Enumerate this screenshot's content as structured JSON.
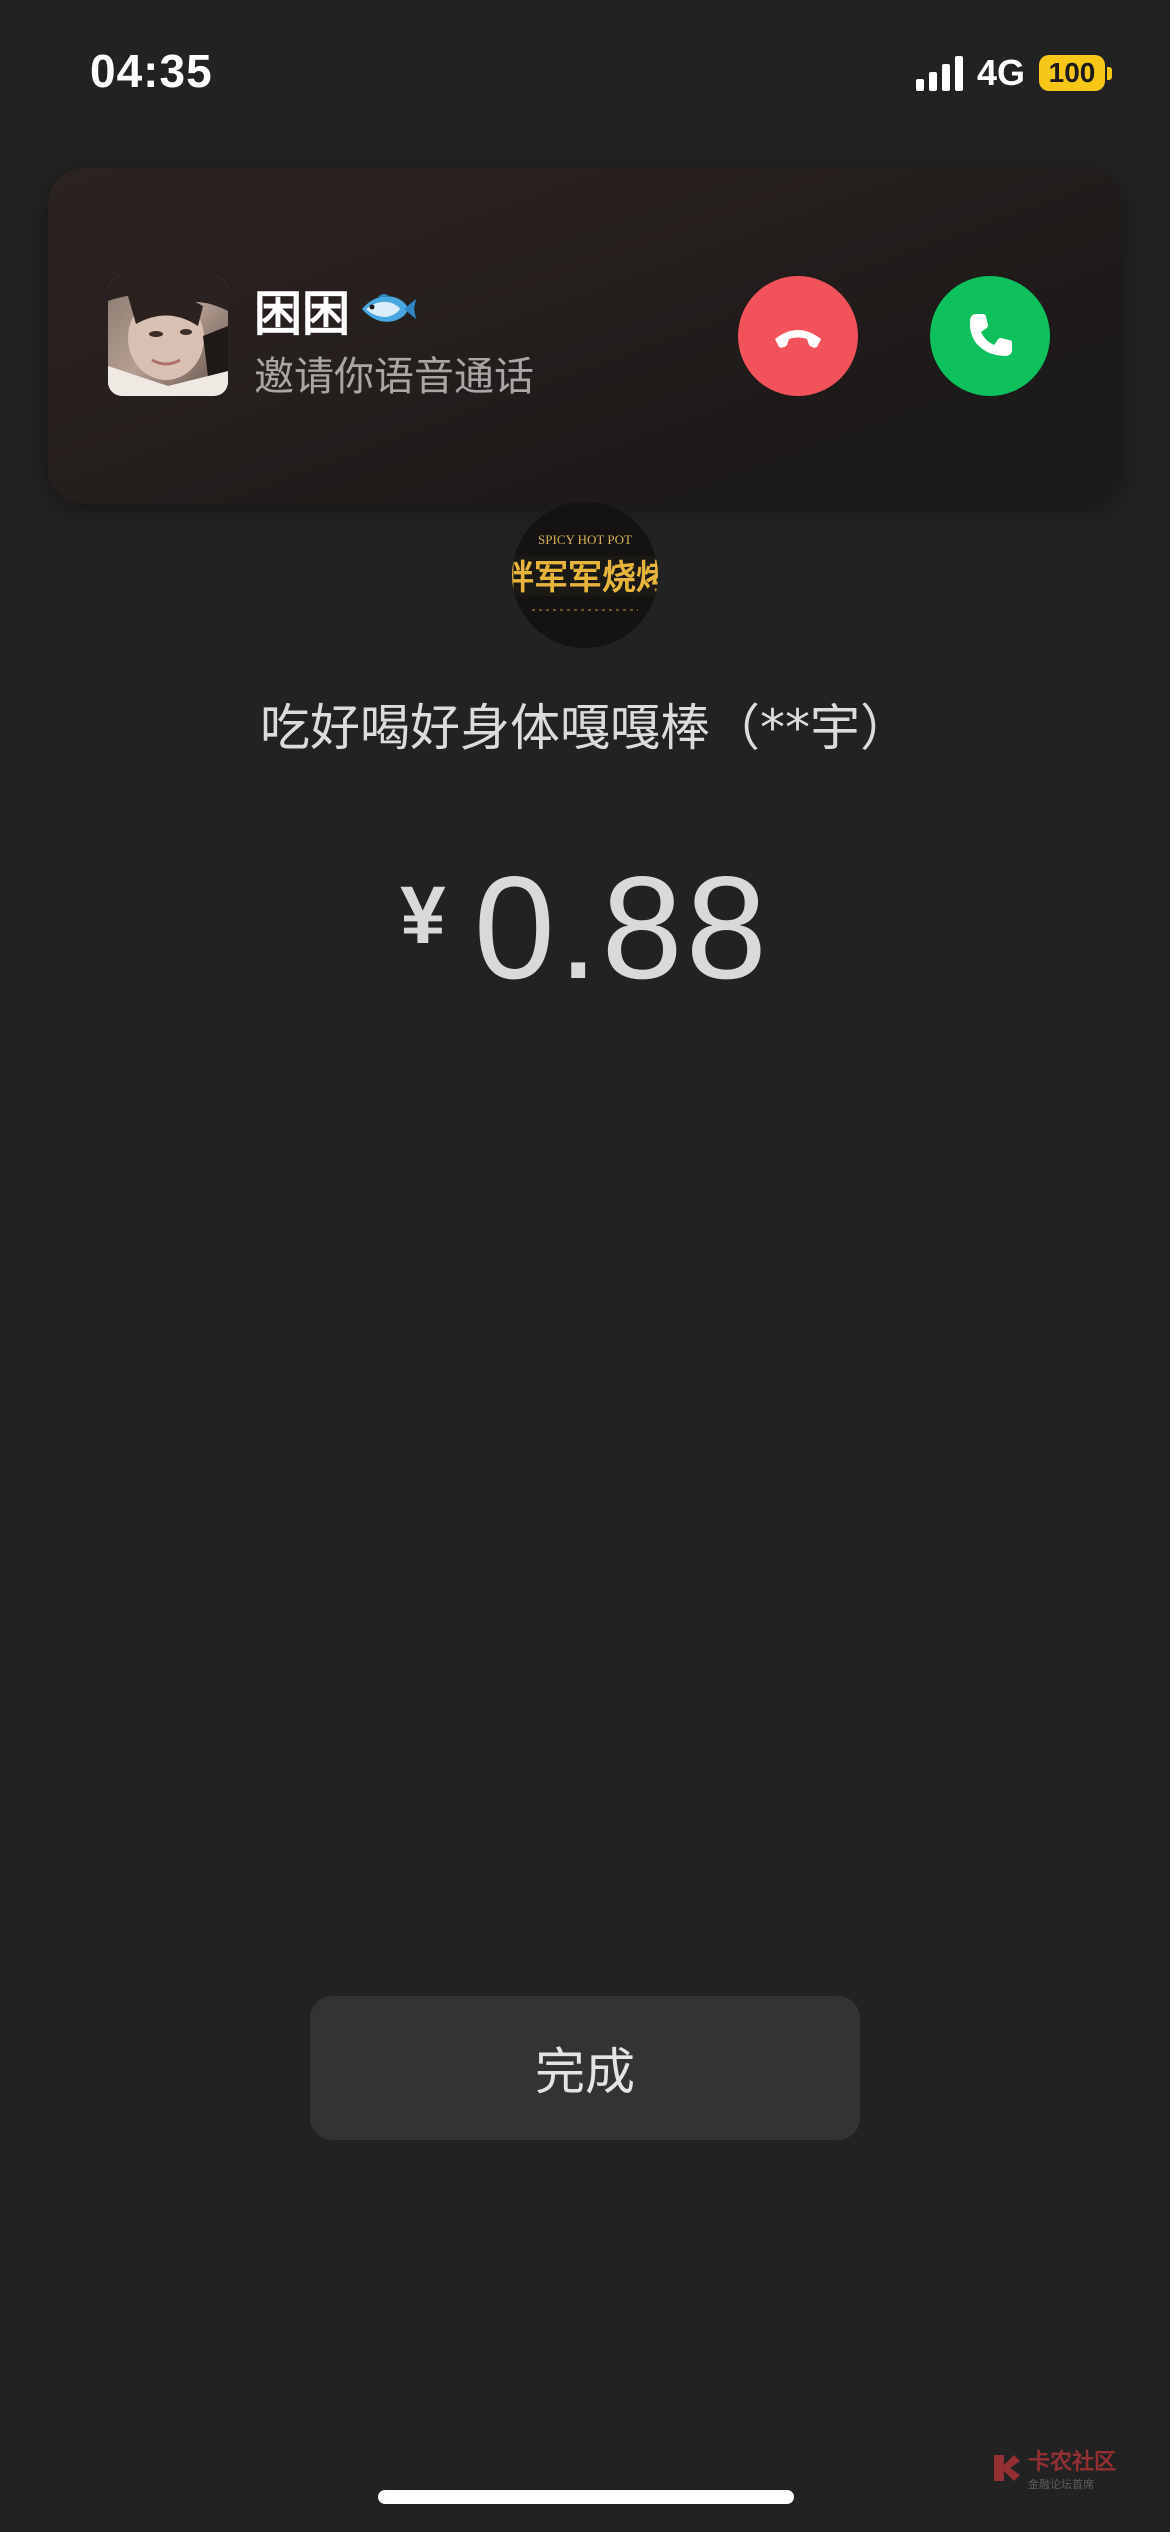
{
  "status_bar": {
    "time": "04:35",
    "network": "4G",
    "battery": "100"
  },
  "call": {
    "caller_name": "困困",
    "subtitle": "邀请你语音通话",
    "icons": {
      "decline": "phone-hangup-icon",
      "accept": "phone-icon",
      "emoji": "fish-icon"
    },
    "colors": {
      "decline": "#f2535a",
      "accept": "#0ec15d"
    }
  },
  "merchant": {
    "logo_top_text": "SPICY HOT POT",
    "logo_main_text": "胖军军烧烤",
    "name": "吃好喝好身体嘎嘎棒（**宇）"
  },
  "payment": {
    "currency_symbol": "¥",
    "amount": "0.88"
  },
  "actions": {
    "done_label": "完成"
  },
  "watermark": {
    "title": "卡农社区",
    "subtitle": "金融论坛首席"
  }
}
